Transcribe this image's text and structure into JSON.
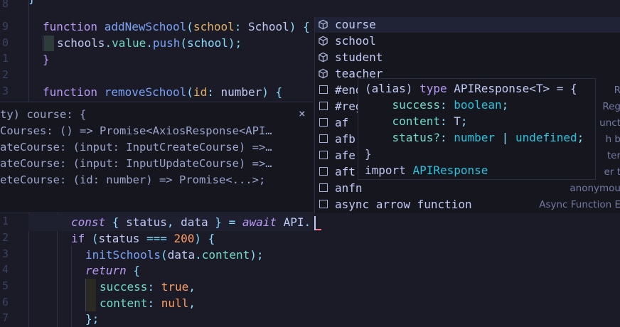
{
  "line_numbers": [
    "8",
    "9",
    "0",
    "1",
    "2",
    "3",
    "",
    "",
    "",
    "",
    "",
    "",
    "",
    "1",
    "2",
    "3",
    "4",
    "5",
    "6",
    "7"
  ],
  "code": {
    "fn1": {
      "kw": "function",
      "name": "addNewSchool",
      "open": "(",
      "param": "school",
      "colon": ": ",
      "type": "School",
      "close": ") {"
    },
    "push": {
      "obj": "schools",
      "dot1": ".",
      "prop": "value",
      "dot2": ".",
      "method": "push",
      "args": "(school);"
    },
    "brace1": "}",
    "fn2": {
      "kw": "function",
      "name": "removeSchool",
      "open": "(",
      "param": "id",
      "colon": ": ",
      "type": "number",
      "close": ") {"
    },
    "const_line": {
      "kw": "const",
      "lb": " { ",
      "a": "status",
      "comma": ", ",
      "b": "data",
      "rb": " } ",
      "eq": "= ",
      "await": "await",
      "api": " API",
      "dot": "."
    },
    "if_line": {
      "kw": "if",
      "rest1": " (",
      "status": "status",
      "op": " === ",
      "num": "200",
      "rest2": ") {"
    },
    "init_line": {
      "fn": "initSchools",
      "p1": "(",
      "obj": "data",
      "dot": ".",
      "prop": "content",
      "p2": ");"
    },
    "return_line": {
      "kw": "return",
      "brace": " {"
    },
    "success_line": {
      "key": "success",
      "colon": ": ",
      "val": "true",
      "comma": ","
    },
    "content_line": {
      "key": "content",
      "colon": ": ",
      "val": "null",
      "comma": ","
    },
    "close_line": "};"
  },
  "hover_panel": {
    "lines": [
      "ty) course: {",
      "Courses: () => Promise<AxiosResponse<API…",
      "ateCourse: (input: InputCreateCourse) =>…",
      "ateCourse: (input: InputUpdateCourse) =>…",
      "eteCourse: (id: number) => Promise<...>;"
    ],
    "close": "×"
  },
  "suggestions": [
    {
      "label": "course",
      "detail": "",
      "icon": "cube-icon"
    },
    {
      "label": "school",
      "detail": "",
      "icon": "cube-icon"
    },
    {
      "label": "student",
      "detail": "",
      "icon": "cube-icon"
    },
    {
      "label": "teacher",
      "detail": "",
      "icon": "cube-icon"
    },
    {
      "label": "#end",
      "detail": "R",
      "icon": "snippet-icon"
    },
    {
      "label": "#reg",
      "detail": "Reg",
      "icon": "snippet-icon"
    },
    {
      "label": "af",
      "detail": "unct",
      "icon": "snippet-icon"
    },
    {
      "label": "afb",
      "detail": "h b",
      "icon": "snippet-icon"
    },
    {
      "label": "afe",
      "detail": "ter",
      "icon": "snippet-icon"
    },
    {
      "label": "aft",
      "detail": "er t",
      "icon": "snippet-icon"
    },
    {
      "label": "anfn",
      "detail": "anonymou",
      "icon": "snippet-icon"
    },
    {
      "label": "async arrow function",
      "detail": "Async Function E",
      "icon": "snippet-icon"
    }
  ],
  "detail_popup": {
    "l1": {
      "a": "(alias) ",
      "kw": "type ",
      "name": "APIResponse",
      "gen": "<T> = {"
    },
    "l2": {
      "key": "    success",
      "colon": ": ",
      "type": "boolean",
      "semi": ";"
    },
    "l3": {
      "key": "    content",
      "colon": ": ",
      "type": "T",
      "semi": ";"
    },
    "l4": {
      "key": "    status?",
      "colon": ": ",
      "type": "number",
      "bar": " | ",
      "type2": "undefined",
      "semi": ";"
    },
    "l5": "}",
    "l6": {
      "kw": "import ",
      "name": "APIResponse"
    }
  }
}
